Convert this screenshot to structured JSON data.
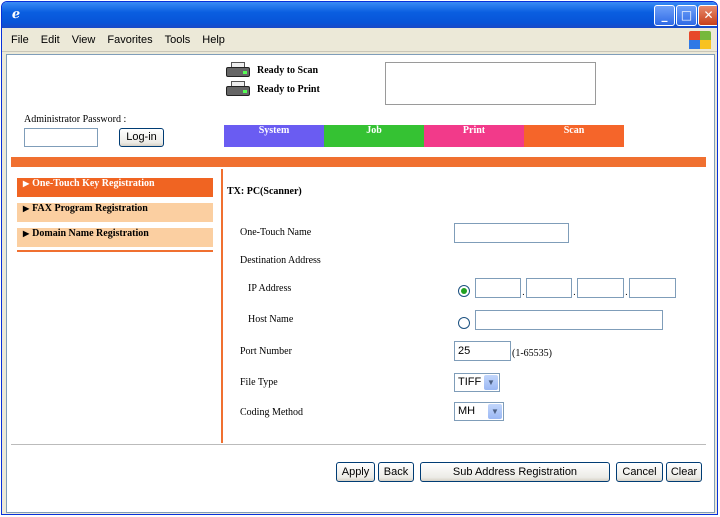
{
  "window": {
    "app_icon": "ie-icon",
    "controls": {
      "minimize": "_",
      "maximize": "□",
      "close": "✕"
    }
  },
  "menubar": {
    "items": [
      "File",
      "Edit",
      "View",
      "Favorites",
      "Tools",
      "Help"
    ]
  },
  "status": {
    "scan": "Ready to Scan",
    "print": "Ready to Print"
  },
  "admin": {
    "label": "Administrator Password :",
    "password_value": "",
    "login_button": "Log-in"
  },
  "tabs": [
    {
      "label": "System",
      "color": "#6a5cf2"
    },
    {
      "label": "Job",
      "color": "#35c233"
    },
    {
      "label": "Print",
      "color": "#f23a8a"
    },
    {
      "label": "Scan",
      "color": "#f5652a"
    }
  ],
  "left_nav": {
    "items": [
      {
        "label": "One-Touch Key Registration",
        "active": true
      },
      {
        "label": "FAX Program Registration",
        "active": false
      },
      {
        "label": "Domain Name Registration",
        "active": false
      }
    ]
  },
  "form": {
    "section_title": "TX: PC(Scanner)",
    "one_touch_name_label": "One-Touch Name",
    "one_touch_name_value": "",
    "destination_label": "Destination Address",
    "ip_label": "IP Address",
    "ip_selected": true,
    "ip_octets": [
      "",
      "",
      "",
      ""
    ],
    "ip_separator": ".",
    "host_label": "Host Name",
    "host_value": "",
    "port_label": "Port Number",
    "port_value": "25",
    "port_hint": "(1-65535)",
    "file_type_label": "File Type",
    "file_type_value": "TIFF",
    "coding_label": "Coding Method",
    "coding_value": "MH"
  },
  "actions": {
    "apply": "Apply",
    "back": "Back",
    "sub_address": "Sub Address Registration",
    "cancel": "Cancel",
    "clear": "Clear"
  }
}
